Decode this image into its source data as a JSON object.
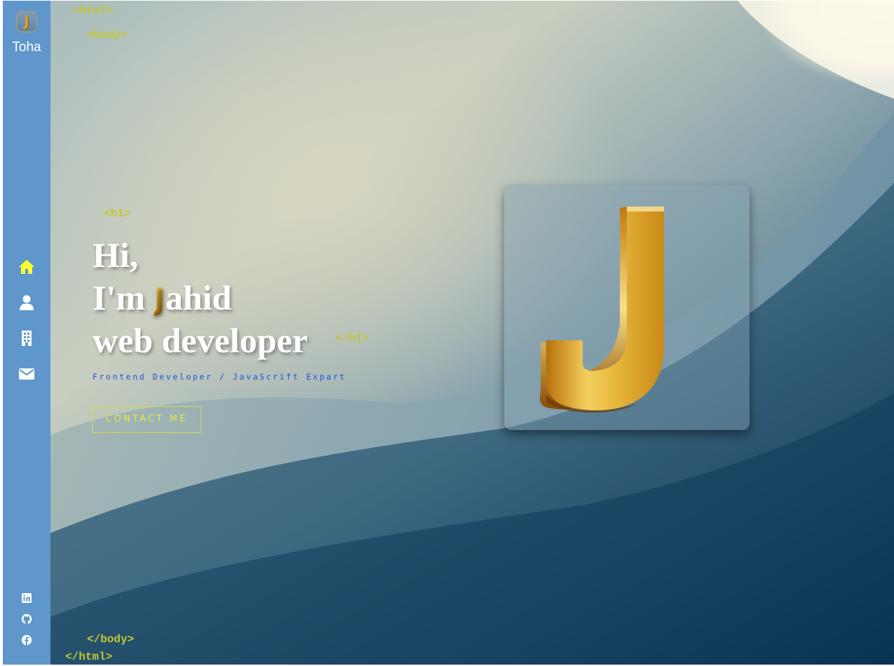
{
  "brand": {
    "logo_letter": "J",
    "name": "Toha"
  },
  "nav": {
    "items": [
      {
        "icon": "home-icon",
        "active": true
      },
      {
        "icon": "user-icon",
        "active": false
      },
      {
        "icon": "building-icon",
        "active": false
      },
      {
        "icon": "envelope-icon",
        "active": false
      }
    ],
    "active_color": "#ffff33"
  },
  "social": [
    "linkedin-icon",
    "github-icon",
    "facebook-icon"
  ],
  "code_tags": {
    "html_open": "<html>",
    "body_open": "<body>",
    "h1_open": "<h1>",
    "h1_close": "</h1>",
    "body_close": "</body>",
    "html_close": "</html>"
  },
  "hero": {
    "line1": "Hi,",
    "line2_prefix": "I'm ",
    "line2_initial": "J",
    "line2_rest": "ahid",
    "line3": "web developer",
    "subtitle": "Frontend Developer / JavaScrift Expart",
    "cta": "CONTACT ME"
  },
  "colors": {
    "sidebar": "#5f96cc",
    "tag": "#c4c832",
    "subtitle": "#2050e0",
    "gold": "#d89a1e"
  }
}
